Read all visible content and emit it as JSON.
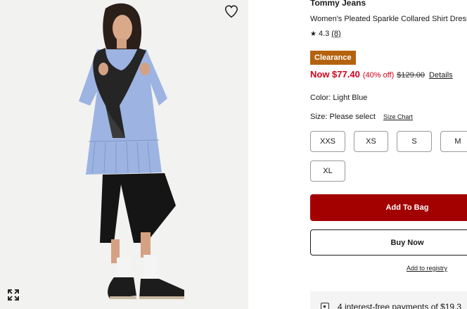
{
  "product": {
    "brand": "Tommy Jeans",
    "title": "Women's Pleated Sparkle Collared Shirt Dress",
    "rating": "4.3",
    "review_count": "(8)",
    "badge": "Clearance",
    "price_now": "Now $77.40",
    "discount": "(40% off)",
    "price_was": "$129.00",
    "details_link": "Details",
    "color_label": "Color: Light Blue",
    "size_label": "Size: Please select",
    "size_chart_link": "Size Chart",
    "sizes": [
      "XXS",
      "XS",
      "S",
      "M",
      "XL"
    ]
  },
  "actions": {
    "add_to_bag": "Add To Bag",
    "buy_now": "Buy Now",
    "add_to_registry": "Add to registry"
  },
  "payment": {
    "text": "4 interest-free payments of $19.3"
  },
  "icons": {
    "favorite": "heart-icon",
    "expand": "expand-icon",
    "star": "star-icon",
    "payment": "payment-icon"
  },
  "colors": {
    "clearance": "#b5620e",
    "sale_red": "#d0021b",
    "bag_button": "#a30000"
  }
}
